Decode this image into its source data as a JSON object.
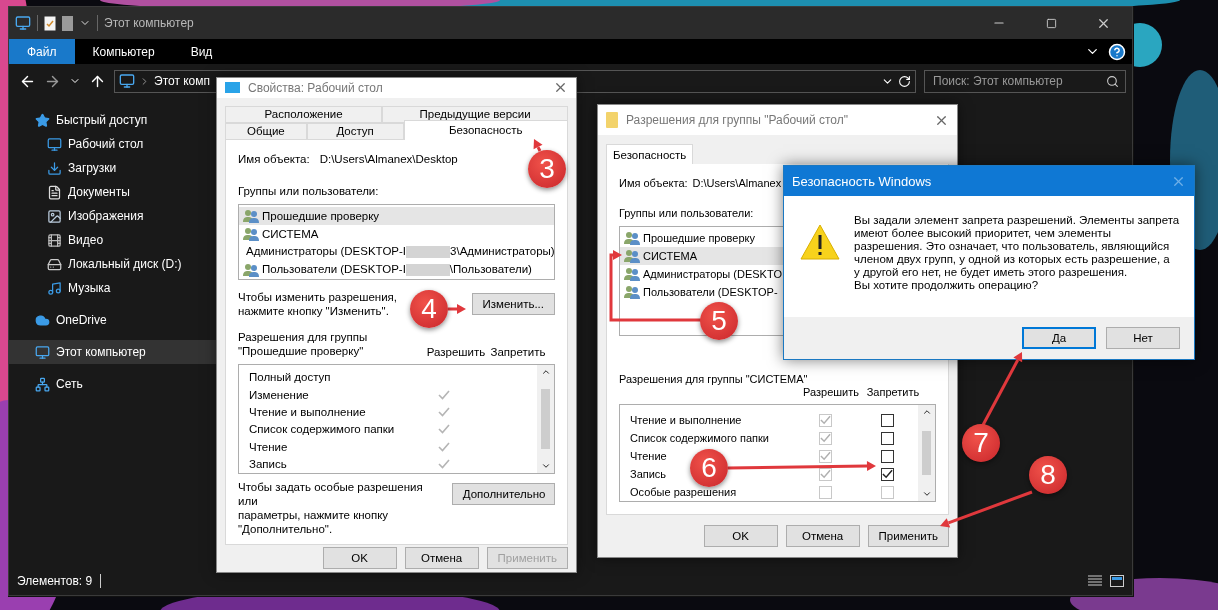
{
  "explorer": {
    "title": "Этот компьютер",
    "ribbon_tabs": [
      {
        "label": "Файл",
        "selected": true
      },
      {
        "label": "Компьютер",
        "selected": false
      },
      {
        "label": "Вид",
        "selected": false
      }
    ],
    "address": "Этот комп",
    "search": {
      "placeholder": "Поиск: Этот компьютер"
    },
    "sidebar": {
      "items": [
        {
          "label": "Быстрый доступ",
          "selected": false,
          "children": [
            {
              "label": "Рабочий стол",
              "selected": false
            },
            {
              "label": "Загрузки",
              "selected": false
            },
            {
              "label": "Документы",
              "selected": false
            },
            {
              "label": "Изображения",
              "selected": false
            },
            {
              "label": "Видео",
              "selected": false
            },
            {
              "label": "Локальный диск (D:)",
              "selected": false
            },
            {
              "label": "Музыка",
              "selected": false
            }
          ]
        },
        {
          "label": "OneDrive",
          "selected": false
        },
        {
          "label": "Этот компьютер",
          "selected": true
        },
        {
          "label": "Сеть",
          "selected": false
        }
      ]
    },
    "status": "Элементов: 9"
  },
  "properties_dialog": {
    "title": "Свойства: Рабочий стол",
    "tabs_back": [
      {
        "label": "Расположение",
        "selected": false
      },
      {
        "label": "Предыдущие версии",
        "selected": false
      }
    ],
    "tabs_front": [
      {
        "label": "Общие",
        "selected": false
      },
      {
        "label": "Доступ",
        "selected": false
      },
      {
        "label": "Безопасность",
        "selected": true
      }
    ],
    "object_label": "Имя объекта:",
    "object_value": "D:\\Users\\Almanex\\Desktop",
    "groups_label": "Группы или пользователи:",
    "groups": [
      {
        "prefix": "Прошедшие проверку",
        "selected": true
      },
      {
        "prefix": "СИСТЕМА",
        "selected": false
      },
      {
        "prefix": "Администраторы (DESKTOP-I",
        "suffix": "3\\Администраторы)",
        "selected": false
      },
      {
        "prefix": "Пользователи (DESKTOP-I",
        "suffix": "\\Пользователи)",
        "selected": false
      }
    ],
    "change_hint": "Чтобы изменить разрешения,\nнажмите кнопку \"Изменить\".",
    "change_button": "Изменить...",
    "perm_label": "Разрешения для группы\n\"Прошедшие проверку\"",
    "allow_header": "Разрешить",
    "deny_header": "Запретить",
    "permissions": [
      {
        "name": "Полный доступ",
        "allow": false,
        "deny": false
      },
      {
        "name": "Изменение",
        "allow": true,
        "deny": false
      },
      {
        "name": "Чтение и выполнение",
        "allow": true,
        "deny": false
      },
      {
        "name": "Список содержимого папки",
        "allow": true,
        "deny": false
      },
      {
        "name": "Чтение",
        "allow": true,
        "deny": false
      },
      {
        "name": "Запись",
        "allow": true,
        "deny": false
      }
    ],
    "advanced_hint": "Чтобы задать особые разрешения или\nпараметры, нажмите кнопку\n\"Дополнительно\".",
    "advanced_button": "Дополнительно",
    "buttons": [
      {
        "label": "OK",
        "disabled": false
      },
      {
        "label": "Отмена",
        "disabled": false
      },
      {
        "label": "Применить",
        "disabled": true
      }
    ]
  },
  "permissions_dialog": {
    "title": "Разрешения для группы \"Рабочий стол\"",
    "tabs": [
      {
        "label": "Безопасность",
        "selected": true
      }
    ],
    "object_label": "Имя объекта:",
    "object_value": "D:\\Users\\Almanex",
    "groups_label": "Группы или пользователи:",
    "groups": [
      {
        "label": "Прошедшие проверку",
        "selected": false
      },
      {
        "label": "СИСТЕМА",
        "selected": true
      },
      {
        "label": "Администраторы (DESKTO",
        "selected": false
      },
      {
        "label": "Пользователи (DESKTOP-",
        "selected": false
      }
    ],
    "perm_label": "Разрешения для группы \"СИСТЕМА\"",
    "allow_header": "Разрешить",
    "deny_header": "Запретить",
    "permissions": [
      {
        "name": "Чтение и выполнение",
        "allow": true,
        "allow_disabled": true,
        "deny": false,
        "deny_disabled": false
      },
      {
        "name": "Список содержимого папки",
        "allow": true,
        "allow_disabled": true,
        "deny": false,
        "deny_disabled": false
      },
      {
        "name": "Чтение",
        "allow": true,
        "allow_disabled": true,
        "deny": false,
        "deny_disabled": false
      },
      {
        "name": "Запись",
        "allow": true,
        "allow_disabled": true,
        "deny": true,
        "deny_disabled": false
      },
      {
        "name": "Особые разрешения",
        "allow": false,
        "allow_disabled": true,
        "deny": false,
        "deny_disabled": true
      }
    ],
    "buttons": [
      {
        "label": "OK",
        "disabled": false
      },
      {
        "label": "Отмена",
        "disabled": false
      },
      {
        "label": "Применить",
        "disabled": false
      }
    ]
  },
  "security_alert": {
    "title": "Безопасность Windows",
    "message": "Вы задали элемент запрета разрешений. Элементы запрета\nимеют более высокий приоритет, чем элементы\nразрешения. Это означает, что пользователь, являющийся\nчленом двух групп, у одной из которых есть разрешение, а\nу другой его нет, не будет иметь этого разрешения.\nВы хотите продолжить операцию?",
    "buttons": [
      {
        "label": "Да",
        "selected": true
      },
      {
        "label": "Нет",
        "selected": false
      }
    ]
  },
  "steps": [
    {
      "label": "3"
    },
    {
      "label": "4"
    },
    {
      "label": "5"
    },
    {
      "label": "6"
    },
    {
      "label": "7"
    },
    {
      "label": "8"
    }
  ]
}
